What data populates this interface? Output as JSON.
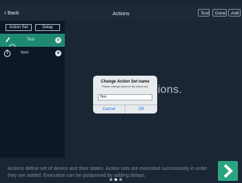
{
  "navbar": {
    "back_label": "Back",
    "title": "Actions",
    "buttons": [
      "Test",
      "Done",
      "Add"
    ]
  },
  "left_panel": {
    "segments": [
      "Action Set",
      "Delay"
    ],
    "items": [
      {
        "label": "Test",
        "selected": true
      },
      {
        "label": "Item",
        "selected": false
      }
    ]
  },
  "main": {
    "background_text": "tions."
  },
  "dialog": {
    "title": "Change Action Set name",
    "message": "Please change name of the action set.",
    "input_value": "Test",
    "cancel_label": "Cancel",
    "ok_label": "OK"
  },
  "footer": {
    "description": "Actions define set of device and their states. Action sets are executed successively in order they are added. Execution can be postponed by adding delays."
  },
  "pager": {
    "count": 3,
    "active": 1
  },
  "colors": {
    "accent": "#2aa57f",
    "selected_row": "#1f8a72",
    "link": "#1a73e8"
  }
}
